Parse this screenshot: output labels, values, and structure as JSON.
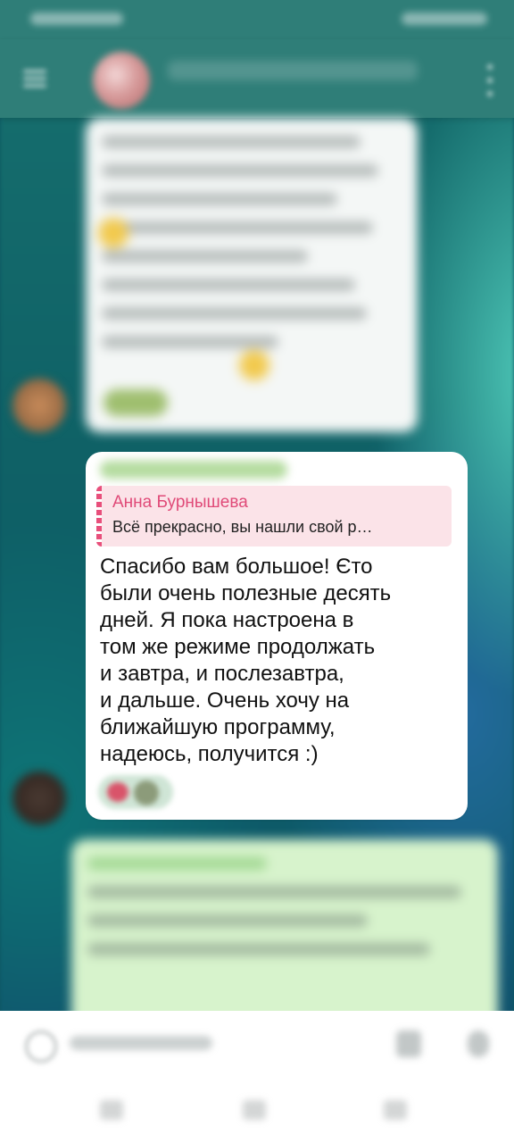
{
  "header": {
    "title": "",
    "back_icon": "arrow-left-icon",
    "menu_icon": "more-vertical-icon"
  },
  "messages": {
    "main": {
      "reply": {
        "author": "Анна Бурнышева",
        "text": "Всё прекрасно,  вы нашли свой р…"
      },
      "text": "Спасибо вам большое! Єто\nбыли очень полезные десять\nдней. Я пока настроена  в\nтом же режиме продолжать\nи завтра,  и послезавтра,\nи дальше. Очень хочу на\nближайшую программу,\nнадеюсь, получится :)"
    }
  },
  "composer": {
    "emoji_icon": "emoji-icon",
    "attach_icon": "paperclip-icon",
    "mic_icon": "microphone-icon"
  },
  "colors": {
    "header_bg": "#2f7e78",
    "reply_accent": "#e04a78",
    "reply_bg": "#fbe3e8",
    "incoming_bubble": "#ffffff",
    "outgoing_bubble": "#d7f3cc"
  }
}
